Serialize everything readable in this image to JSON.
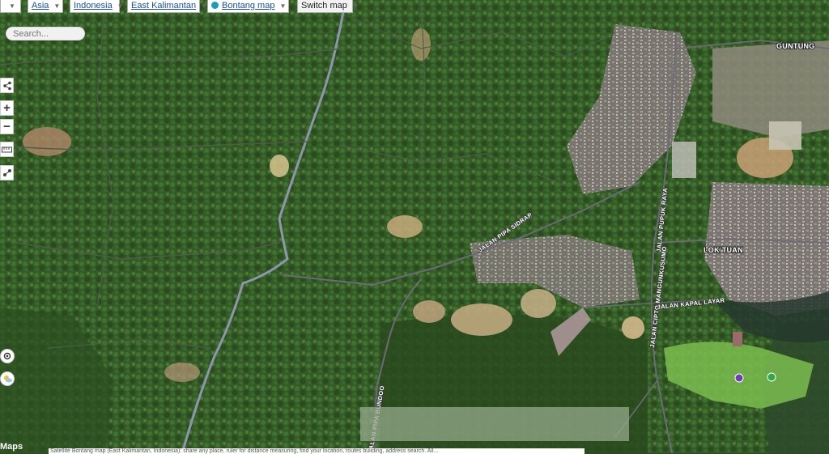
{
  "breadcrumb": {
    "asia": "Asia",
    "indonesia": "Indonesia",
    "province": "East Kalimantan",
    "city": "Bontang map",
    "switch": "Switch map"
  },
  "search": {
    "placeholder": "Search..."
  },
  "places": {
    "guntung": "GUNTUNG",
    "lok_tuan": "LOK TUAN"
  },
  "roads": {
    "pipa_sidrap": "JALAN PIPA SIDRAP",
    "pupuk_raya": "JALAN PUPUK RAYA",
    "cipto": "JALAN CIPTO MANGUNKUSUMO",
    "kapal_layar": "JALAN KAPAL LAYAR",
    "pipa_bundar": "JALAN PIPA BUNDOO"
  },
  "footer": {
    "logo": "Maps",
    "caption": "Satellite Bontang map (East Kalimantan, Indonesia): share any place, ruler for distance measuring, find your location, routes building, address search. All..."
  },
  "colors": {
    "forest": "#2f4a22",
    "vegetation": "#3d6b2c",
    "clearing": "#b89a6a",
    "urban": "#9c8e8f",
    "road": "#8a90a8",
    "golf": "#7bbd4f"
  }
}
